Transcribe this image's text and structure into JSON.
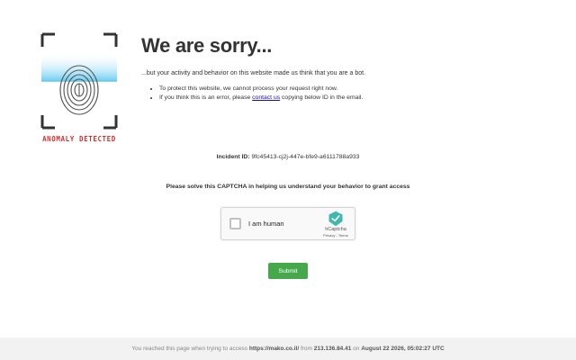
{
  "headline": "We are sorry...",
  "intro": "...but your activity and behavior on this website made us think that you are a bot.",
  "reasons": {
    "item1": "To protect this website, we cannot process your request right now.",
    "item2_prefix": "If you think this is an error, please",
    "contact_link": "contact us",
    "item2_suffix": "copying below ID in the email."
  },
  "logo": {
    "caption": "ANOMALY DETECTED",
    "icon": "fingerprint-scan-icon"
  },
  "incident": {
    "label": "Incident ID:",
    "value": "9fc45413-cj2j-447e-bfe9-a6111788a933"
  },
  "captcha_instruction": "Please solve this CAPTCHA in helping us understand your behavior to grant access",
  "captcha": {
    "checkbox_label": "I am human",
    "brand": "hCaptcha",
    "privacy": "Privacy",
    "separator": " - ",
    "terms": "Terms"
  },
  "submit_label": "Submit",
  "footer": {
    "prefix": "You reached this page when trying to access",
    "url": "https://mako.co.il/",
    "from": "from",
    "ip": "213.136.84.41",
    "on": "on",
    "datetime": "August 22 2026, 05:02:27 UTC"
  },
  "colors": {
    "accent": "#45a84a",
    "alert": "#d32f2f",
    "link": "#1a0dab",
    "scan": "#5ec8f0"
  }
}
